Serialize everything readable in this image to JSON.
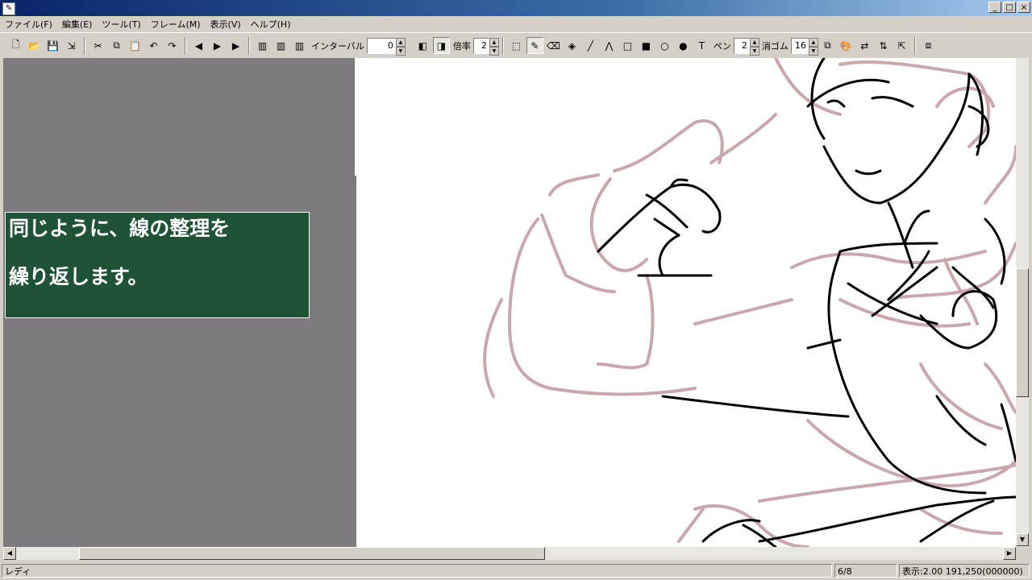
{
  "menu": [
    "ファイル(F)",
    "編集(E)",
    "ツール(T)",
    "フレーム(M)",
    "表示(V)",
    "ヘルプ(H)"
  ],
  "toolbar": {
    "interval_label": "インターバル",
    "interval_value": "0",
    "zoom_label": "倍率",
    "zoom_value": "2",
    "pen_label": "ペン",
    "pen_value": "2",
    "eraser_label": "消ゴム",
    "eraser_value": "16",
    "text_tool": "T"
  },
  "caption": {
    "line1": "同じように、線の整理を",
    "line2": "繰り返します。"
  },
  "status": {
    "ready": "レディ",
    "frame": "6/8",
    "zoom_coords": "表示:2.00   191,250(000000)"
  }
}
